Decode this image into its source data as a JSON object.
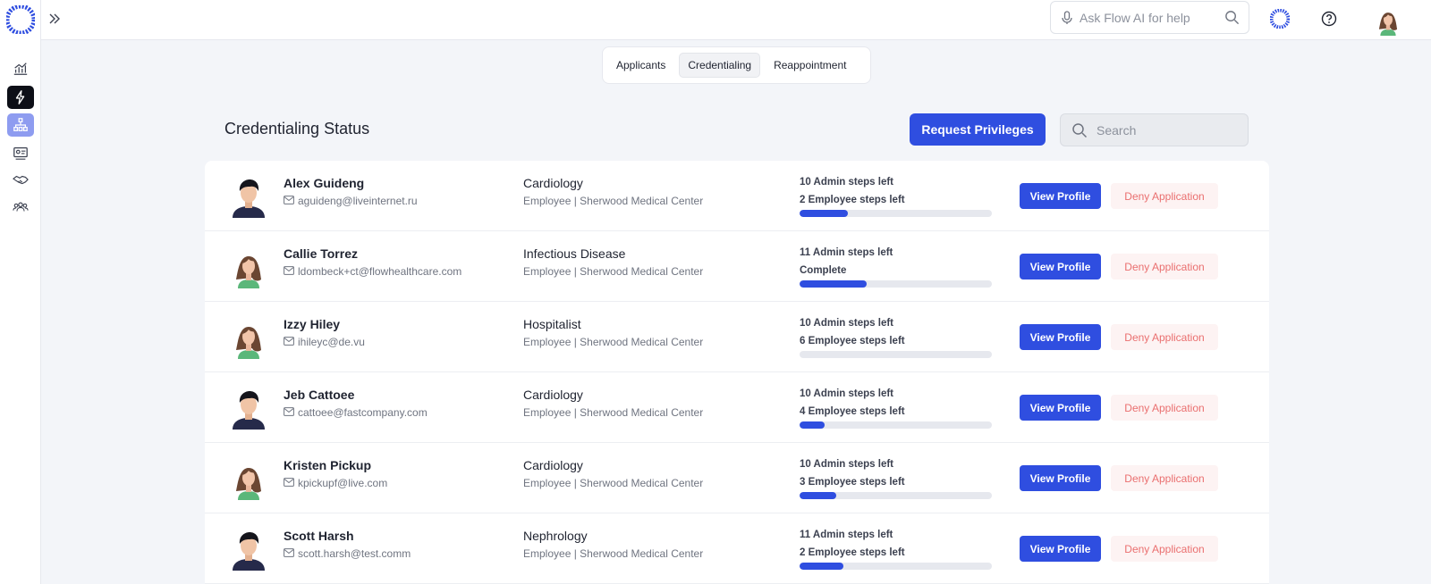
{
  "topbar": {
    "ask_placeholder": "Ask Flow AI for help"
  },
  "tabs": [
    {
      "label": "Applicants",
      "selected": false
    },
    {
      "label": "Credentialing",
      "selected": true
    },
    {
      "label": "Reappointment",
      "selected": false
    }
  ],
  "page": {
    "title": "Credentialing Status",
    "request_button": "Request Privileges",
    "search_placeholder": "Search"
  },
  "buttons": {
    "view": "View Profile",
    "deny": "Deny Application"
  },
  "colors": {
    "accent": "#2f4ee0",
    "deny_text": "#ea6f6f",
    "deny_bg": "#fdf3f3",
    "background": "#f3f5f9"
  },
  "sidebar": {
    "icons": [
      "analytics-icon",
      "flow-bolt-icon",
      "org-chart-icon",
      "id-card-icon",
      "handshake-icon",
      "team-icon"
    ]
  },
  "applicants": [
    {
      "name": "Alex Guideng",
      "email": "aguideng@liveinternet.ru",
      "department": "Cardiology",
      "org": "Employee | Sherwood Medical Center",
      "admin_steps": "10 Admin steps left",
      "employee_steps": "2 Employee steps left",
      "progress": 0.25,
      "avatar": "male"
    },
    {
      "name": "Callie Torrez",
      "email": "ldombeck+ct@flowhealthcare.com",
      "department": "Infectious Disease",
      "org": "Employee | Sherwood Medical Center",
      "admin_steps": "11 Admin steps left",
      "employee_steps": "Complete",
      "progress": 0.35,
      "avatar": "female"
    },
    {
      "name": "Izzy Hiley",
      "email": "ihileyc@de.vu",
      "department": "Hospitalist",
      "org": "Employee | Sherwood Medical Center",
      "admin_steps": "10 Admin steps left",
      "employee_steps": "6 Employee steps left",
      "progress": 0.0,
      "avatar": "female"
    },
    {
      "name": "Jeb Cattoee",
      "email": "cattoee@fastcompany.com",
      "department": "Cardiology",
      "org": "Employee | Sherwood Medical Center",
      "admin_steps": "10 Admin steps left",
      "employee_steps": "4 Employee steps left",
      "progress": 0.13,
      "avatar": "male"
    },
    {
      "name": "Kristen Pickup",
      "email": "kpickupf@live.com",
      "department": "Cardiology",
      "org": "Employee | Sherwood Medical Center",
      "admin_steps": "10 Admin steps left",
      "employee_steps": "3 Employee steps left",
      "progress": 0.19,
      "avatar": "female"
    },
    {
      "name": "Scott Harsh",
      "email": "scott.harsh@test.comm",
      "department": "Nephrology",
      "org": "Employee | Sherwood Medical Center",
      "admin_steps": "11 Admin steps left",
      "employee_steps": "2 Employee steps left",
      "progress": 0.23,
      "avatar": "male"
    }
  ]
}
